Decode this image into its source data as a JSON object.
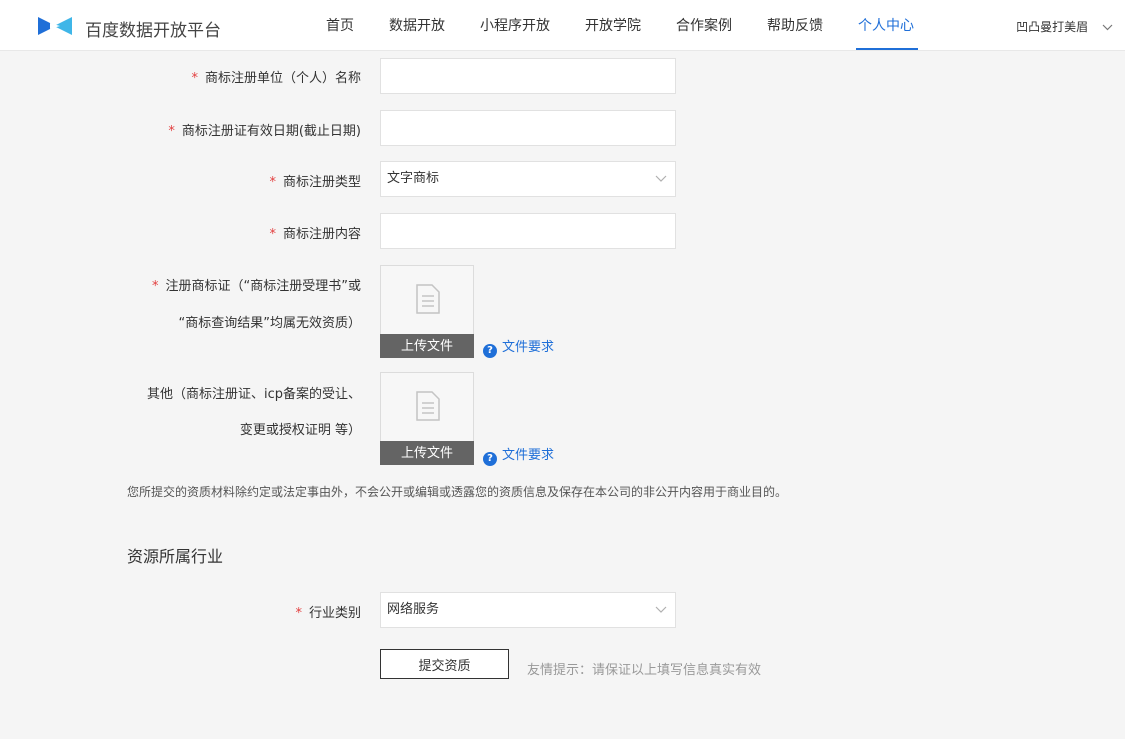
{
  "header": {
    "brand": "百度数据开放平台",
    "nav": [
      "首页",
      "数据开放",
      "小程序开放",
      "开放学院",
      "合作案例",
      "帮助反馈",
      "个人中心"
    ],
    "active_index": 6,
    "user": "凹凸曼打美眉"
  },
  "form": {
    "required_mark": "*",
    "fields": {
      "owner_name": {
        "label": "商标注册单位（个人）名称",
        "value": ""
      },
      "expiry": {
        "label": "商标注册证有效日期(截止日期)",
        "value": ""
      },
      "type": {
        "label": "商标注册类型",
        "value": "文字商标"
      },
      "content": {
        "label": "商标注册内容",
        "value": ""
      }
    },
    "cert": {
      "label_line1": "注册商标证（“商标注册受理书”或",
      "label_line2": "“商标查询结果”均属无效资质）",
      "upload_label": "上传文件",
      "requirements_link": "文件要求"
    },
    "other": {
      "label_line1": "其他（商标注册证、icp备案的受让、",
      "label_line2": "变更或授权证明 等）",
      "upload_label": "上传文件",
      "requirements_link": "文件要求"
    },
    "notice": "您所提交的资质材料除约定或法定事由外，不会公开或编辑或透露您的资质信息及保存在本公司的非公开内容用于商业目的。"
  },
  "industry": {
    "title": "资源所属行业",
    "field_label": "行业类别",
    "value": "网络服务"
  },
  "submit": {
    "label": "提交资质",
    "tip": "友情提示：请保证以上填写信息真实有效"
  },
  "colors": {
    "accent": "#1f6fd8",
    "required": "#e23d3d",
    "upload_bar": "#646464"
  }
}
